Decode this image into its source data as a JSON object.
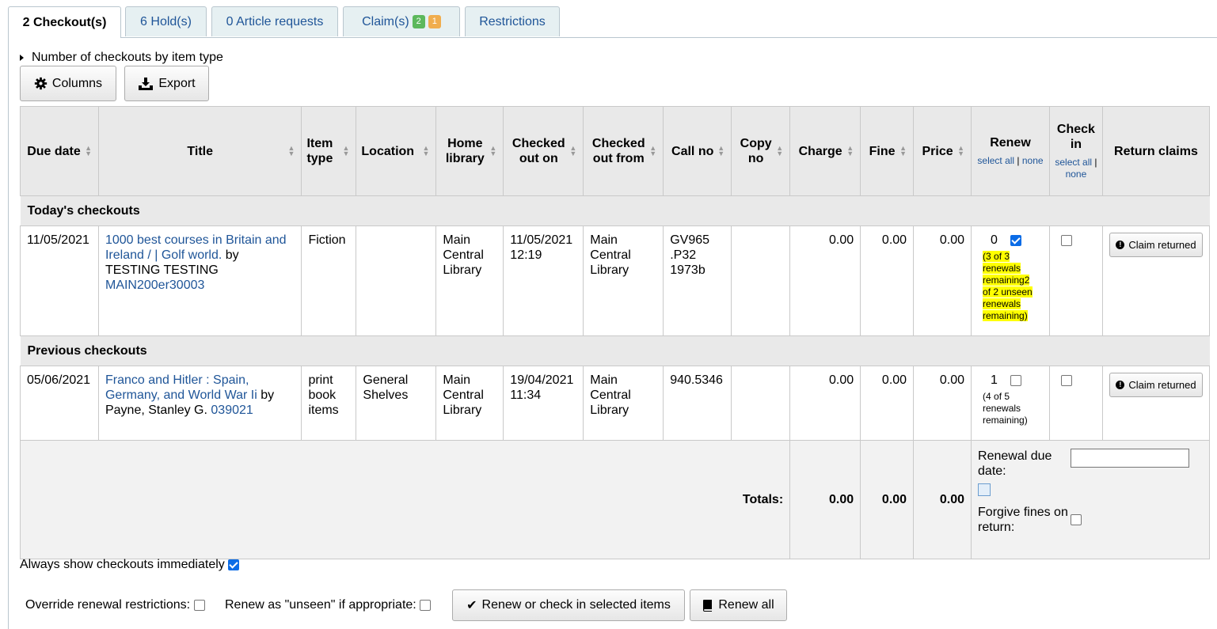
{
  "tabs": [
    {
      "label": "2 Checkout(s)"
    },
    {
      "label": "6 Hold(s)"
    },
    {
      "label": "0 Article requests"
    },
    {
      "label": "Claim(s)",
      "badge_green": "2",
      "badge_orange": "1"
    },
    {
      "label": "Restrictions"
    }
  ],
  "toggle_label": "Number of checkouts by item type",
  "buttons": {
    "columns": "Columns",
    "export": "Export"
  },
  "headers": {
    "due_date": "Due date",
    "title": "Title",
    "item_type": "Item type",
    "location": "Location",
    "home_library": "Home library",
    "checked_out_on": "Checked out on",
    "checked_out_from": "Checked out from",
    "call_no": "Call no",
    "copy_no": "Copy no",
    "charge": "Charge",
    "fine": "Fine",
    "price": "Price",
    "renew": "Renew",
    "renew_select_all": "select all",
    "renew_none": "none",
    "check_in": "Check in",
    "check_in_select_all": "select all",
    "check_in_none": "none",
    "return_claims": "Return claims"
  },
  "groups": {
    "today": "Today's checkouts",
    "previous": "Previous checkouts"
  },
  "rows": [
    {
      "due_date": "11/05/2021",
      "title_link": "1000 best courses in Britain and Ireland / | Golf world.",
      "by": "by",
      "author": "TESTING TESTING",
      "barcode": "MAIN200er30003",
      "item_type": "Fiction",
      "location": "",
      "home_library": "Main Central Library",
      "checked_out_on": "11/05/2021 12:19",
      "checked_out_from": "Main Central Library",
      "call_no": "GV965 .P32 1973b",
      "copy_no": "",
      "charge": "0.00",
      "fine": "0.00",
      "price": "0.00",
      "renew_count": "0",
      "renew_checked": true,
      "renew_info": "(3 of 3 renewals remaining2 of 2 unseen renewals remaining)",
      "claim_label": "Claim returned"
    },
    {
      "due_date": "05/06/2021",
      "title_link": "Franco and Hitler : Spain, Germany, and World War Ii",
      "by": "by",
      "author": "Payne, Stanley G.",
      "barcode": "039021",
      "item_type": "print book items",
      "location": "General Shelves",
      "home_library": "Main Central Library",
      "checked_out_on": "19/04/2021 11:34",
      "checked_out_from": "Main Central Library",
      "call_no": "940.5346",
      "copy_no": "",
      "charge": "0.00",
      "fine": "0.00",
      "price": "0.00",
      "renew_count": "1",
      "renew_checked": false,
      "renew_info": "(4 of 5 renewals remaining)",
      "claim_label": "Claim returned"
    }
  ],
  "totals": {
    "label": "Totals:",
    "charge": "0.00",
    "fine": "0.00",
    "price": "0.00",
    "renewal_due_date_label": "Renewal due date:",
    "renewal_due_date_value": "",
    "forgive_label": "Forgive fines on return:"
  },
  "always_show_label": "Always show checkouts immediately",
  "override_label": "Override renewal restrictions:",
  "unseen_label": "Renew as \"unseen\" if appropriate:",
  "renew_selected_label": "Renew or check in selected items",
  "renew_all_label": "Renew all"
}
